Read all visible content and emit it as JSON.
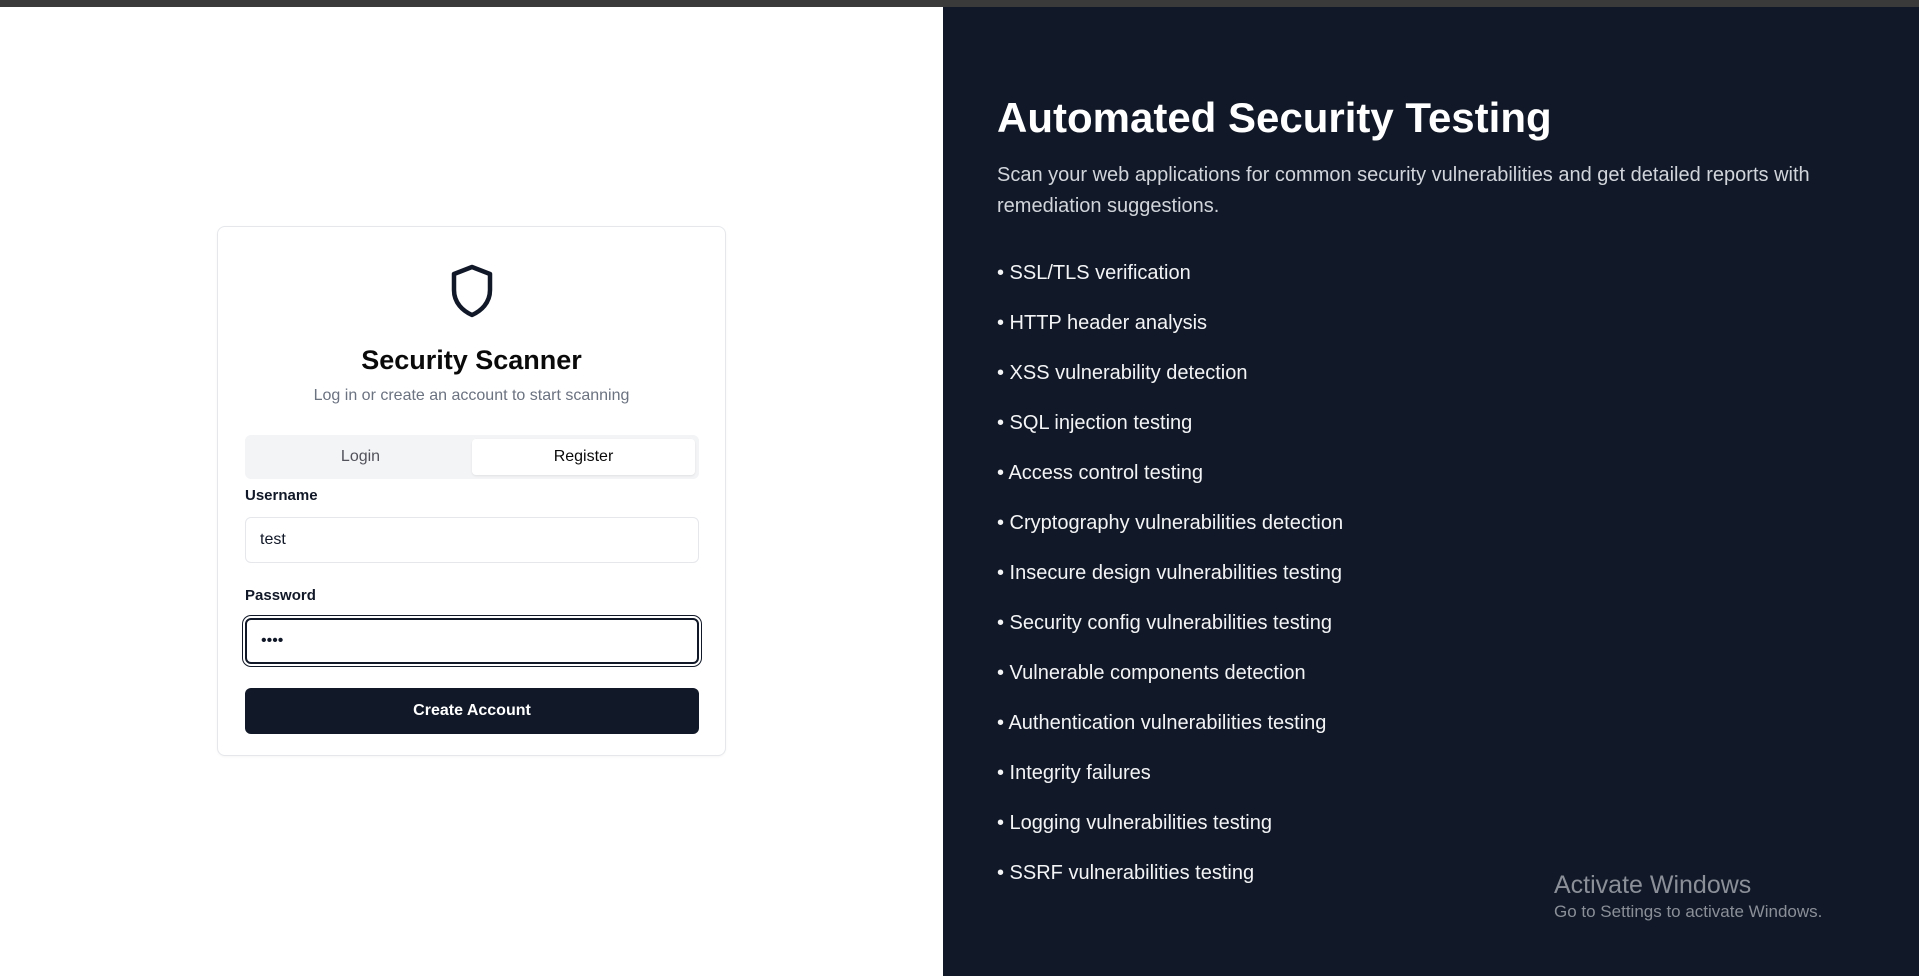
{
  "login_card": {
    "title": "Security Scanner",
    "subtitle": "Log in or create an account to start scanning",
    "tabs": [
      {
        "label": "Login",
        "active": false
      },
      {
        "label": "Register",
        "active": true
      }
    ],
    "username": {
      "label": "Username",
      "value": "test"
    },
    "password": {
      "label": "Password",
      "value": "••••"
    },
    "submit_label": "Create Account"
  },
  "info_panel": {
    "title": "Automated Security Testing",
    "description": "Scan your web applications for common security vulnerabilities and get detailed reports with remediation suggestions.",
    "features": [
      "• SSL/TLS verification",
      "• HTTP header analysis",
      "• XSS vulnerability detection",
      "• SQL injection testing",
      "• Access control testing",
      "• Cryptography vulnerabilities detection",
      "• Insecure design vulnerabilities testing",
      "• Security config vulnerabilities testing",
      "• Vulnerable components detection",
      "• Authentication vulnerabilities testing",
      "• Integrity failures",
      "• Logging vulnerabilities testing",
      "• SSRF vulnerabilities testing"
    ]
  },
  "watermark": {
    "title": "Activate Windows",
    "subtitle": "Go to Settings to activate Windows."
  },
  "icons": {
    "logo": "shield-icon"
  },
  "colors": {
    "primary": "#111827",
    "panel_bg": "#111827",
    "muted_text": "#6b7280"
  }
}
